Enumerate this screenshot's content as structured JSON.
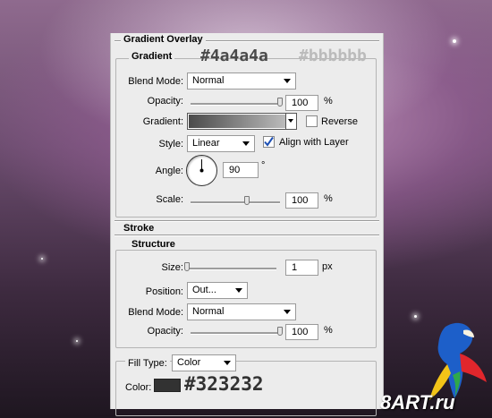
{
  "gradient_overlay": {
    "title": "Gradient Overlay",
    "group_title": "Gradient",
    "hex_dark": "#4a4a4a",
    "hex_light": "#bbbbbb",
    "blend_mode_label": "Blend Mode:",
    "blend_mode_value": "Normal",
    "opacity_label": "Opacity:",
    "opacity_value": "100",
    "opacity_unit": "%",
    "opacity_fraction": 1.0,
    "gradient_label": "Gradient:",
    "gradient_colors": [
      "#4a4a4a",
      "#bbbbbb"
    ],
    "reverse_label": "Reverse",
    "reverse_checked": false,
    "style_label": "Style:",
    "style_value": "Linear",
    "align_label": "Align with Layer",
    "align_checked": true,
    "angle_label": "Angle:",
    "angle_value": "90",
    "angle_unit": "°",
    "scale_label": "Scale:",
    "scale_value": "100",
    "scale_unit": "%",
    "scale_fraction": 0.63
  },
  "stroke": {
    "title": "Stroke",
    "group_title": "Structure",
    "size_label": "Size:",
    "size_value": "1",
    "size_unit": "px",
    "size_fraction": 0.0,
    "position_label": "Position:",
    "position_value": "Out...",
    "blend_mode_label": "Blend Mode:",
    "blend_mode_value": "Normal",
    "opacity_label": "Opacity:",
    "opacity_value": "100",
    "opacity_unit": "%",
    "opacity_fraction": 1.0,
    "fill_type_label": "Fill Type:",
    "fill_type_value": "Color",
    "color_label": "Color:",
    "color_hex": "#323232",
    "swatch_color": "#323232"
  },
  "watermark": {
    "text": "8ART.ru"
  },
  "colors": {
    "panel_bg": "#ececec",
    "accent_check": "#1c4fb4"
  }
}
